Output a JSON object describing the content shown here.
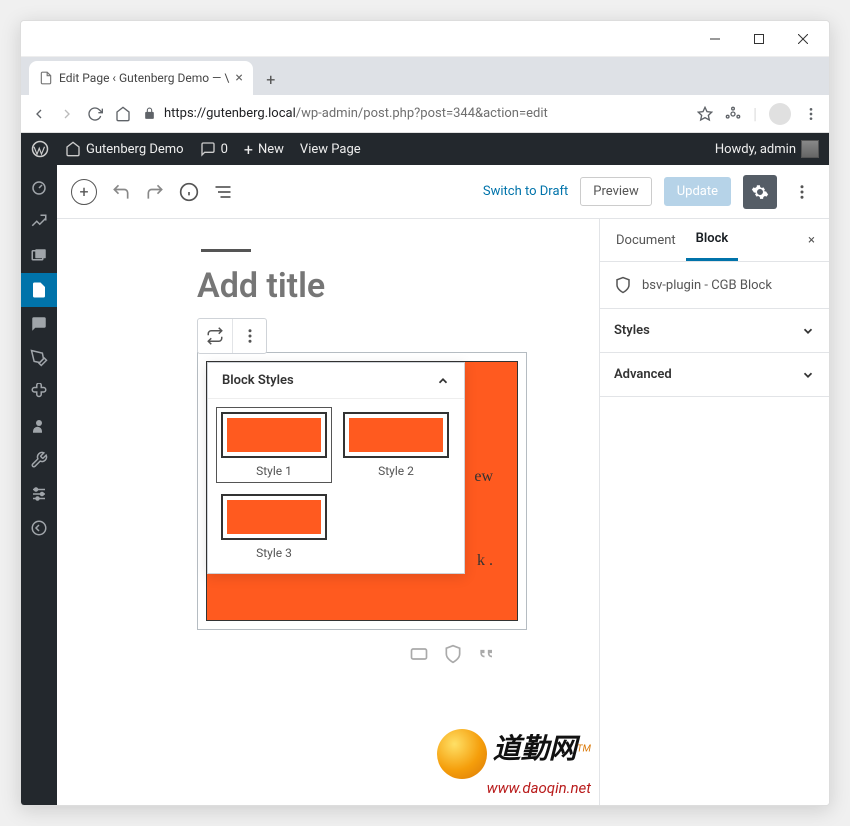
{
  "browser": {
    "tab_title": "Edit Page ‹ Gutenberg Demo — \\",
    "url_host": "https://gutenberg.local",
    "url_path": "/wp-admin/post.php?post=344&action=edit"
  },
  "adminbar": {
    "site_name": "Gutenberg Demo",
    "comments_count": "0",
    "new_label": "New",
    "view_page": "View Page",
    "howdy": "Howdy, admin"
  },
  "toolbar": {
    "switch_draft": "Switch to Draft",
    "preview": "Preview",
    "update": "Update"
  },
  "editor": {
    "title_placeholder": "Add title",
    "block_content_hint1": "ew",
    "block_content_hint2": "k ."
  },
  "styles_popup": {
    "header": "Block Styles",
    "items": [
      {
        "label": "Style 1",
        "selected": true
      },
      {
        "label": "Style 2",
        "selected": false
      },
      {
        "label": "Style 3",
        "selected": false
      }
    ]
  },
  "sidebar": {
    "tabs": {
      "document": "Document",
      "block": "Block"
    },
    "block_name": "bsv-plugin - CGB Block",
    "panels": {
      "styles": "Styles",
      "advanced": "Advanced"
    }
  },
  "watermark": {
    "text": "道勤网",
    "tm": "TM",
    "url": "www.daoqin.net"
  }
}
